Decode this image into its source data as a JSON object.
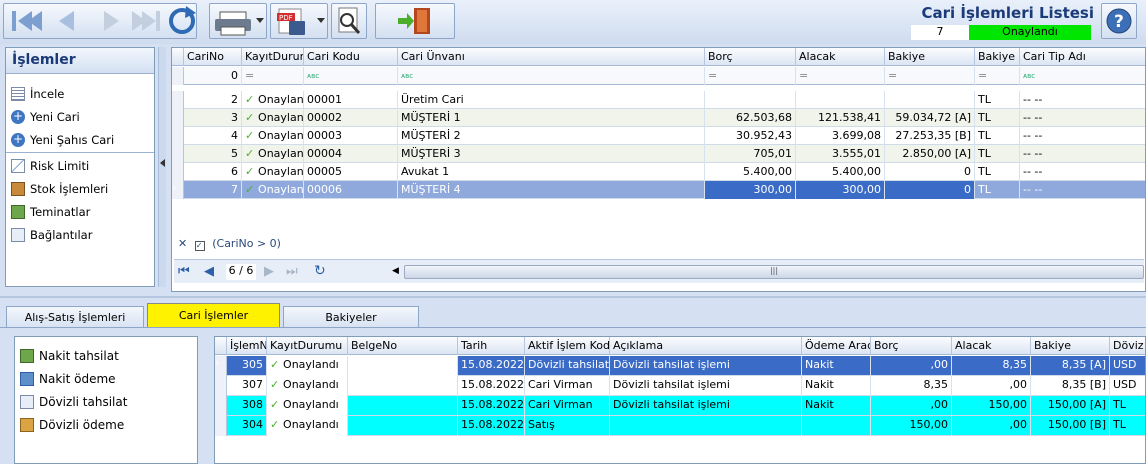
{
  "window": {
    "title": "Cari İşlemleri Listesi",
    "record_count": "7",
    "status": "Onaylandı",
    "status_color": "#00e600"
  },
  "toolbar": {
    "buttons": [
      "first-record-icon",
      "prev-record-icon",
      "next-record-icon",
      "last-record-icon",
      "refresh-icon",
      "print-icon",
      "pdf-save-icon",
      "search-doc-icon",
      "exit-door-icon",
      "help-icon"
    ]
  },
  "left_panel": {
    "title": "İşlemler",
    "items": [
      {
        "label": "İncele",
        "icon": "list-icon"
      },
      {
        "label": "Yeni Cari",
        "icon": "add-icon"
      },
      {
        "label": "Yeni Şahıs Cari",
        "icon": "add-icon"
      },
      {
        "label": "Risk Limiti",
        "icon": "chart-icon"
      },
      {
        "label": "Stok İşlemleri",
        "icon": "box-icon"
      },
      {
        "label": "Teminatlar",
        "icon": "money-icon"
      },
      {
        "label": "Bağlantılar",
        "icon": "link-icon"
      }
    ]
  },
  "top_grid": {
    "columns": [
      "CariNo",
      "KayıtDurumu",
      "Cari Kodu",
      "Cari Ünvanı",
      "Borç",
      "Alacak",
      "Bakiye",
      "Bakiye D",
      "Cari Tip Adı"
    ],
    "filter_value": "0",
    "rows": [
      {
        "no": "2",
        "durum": "Onaylan",
        "kod": "00001",
        "unvan": "Üretim Cari",
        "borc": "",
        "alacak": "",
        "bakiye": "",
        "bd": "TL",
        "tip": "-- --"
      },
      {
        "no": "3",
        "durum": "Onaylan",
        "kod": "00002",
        "unvan": "MÜŞTERİ 1",
        "borc": "62.503,68",
        "alacak": "121.538,41",
        "bakiye": "59.034,72 [A]",
        "bd": "TL",
        "tip": "-- --"
      },
      {
        "no": "4",
        "durum": "Onaylan",
        "kod": "00003",
        "unvan": "MÜŞTERİ 2",
        "borc": "30.952,43",
        "alacak": "3.699,08",
        "bakiye": "27.253,35 [B]",
        "bd": "TL",
        "tip": "-- --"
      },
      {
        "no": "5",
        "durum": "Onaylan",
        "kod": "00004",
        "unvan": "MÜŞTERİ 3",
        "borc": "705,01",
        "alacak": "3.555,01",
        "bakiye": "2.850,00 [A]",
        "bd": "TL",
        "tip": "-- --"
      },
      {
        "no": "6",
        "durum": "Onaylan",
        "kod": "00005",
        "unvan": "Avukat 1",
        "borc": "5.400,00",
        "alacak": "5.400,00",
        "bakiye": "0",
        "bd": "TL",
        "tip": "-- --"
      },
      {
        "no": "7",
        "durum": "Onaylan",
        "kod": "00006",
        "unvan": "MÜŞTERİ 4",
        "borc": "300,00",
        "alacak": "300,00",
        "bakiye": "0",
        "bd": "TL",
        "tip": "-- --"
      }
    ],
    "filter_expr": "(CariNo > 0)",
    "pager": "6 / 6"
  },
  "tabs": [
    "Alış-Satış İşlemleri",
    "Cari İşlemler",
    "Bakiyeler"
  ],
  "bottom_panel": {
    "items": [
      {
        "label": "Nakit tahsilat",
        "icon": "cash-in-icon"
      },
      {
        "label": "Nakit ödeme",
        "icon": "cash-out-icon"
      },
      {
        "label": "Dövizli tahsilat",
        "icon": "fx-in-icon"
      },
      {
        "label": "Dövizli ödeme",
        "icon": "fx-out-icon"
      }
    ]
  },
  "bottom_grid": {
    "columns": [
      "İşlemNo",
      "KayıtDurumu",
      "BelgeNo",
      "Tarih",
      "Aktif İşlem Kodu",
      "Açıklama",
      "Ödeme Aracı",
      "Borç",
      "Alacak",
      "Bakiye",
      "Döviz"
    ],
    "rows": [
      {
        "no": "305",
        "durum": "Onaylandı",
        "belge": "",
        "tarih": "15.08.2022",
        "kod": "Dövizli tahsilat",
        "aciklama": "Dövizli tahsilat işlemi",
        "arac": "Nakit",
        "borc": ",00",
        "alacak": "8,35",
        "bakiye": "8,35 [A]",
        "doviz": "USD"
      },
      {
        "no": "307",
        "durum": "Onaylandı",
        "belge": "",
        "tarih": "15.08.2022",
        "kod": "Cari Virman",
        "aciklama": "Dövizli tahsilat işlemi",
        "arac": "Nakit",
        "borc": "8,35",
        "alacak": ",00",
        "bakiye": "8,35 [B]",
        "doviz": "USD"
      },
      {
        "no": "308",
        "durum": "Onaylandı",
        "belge": "",
        "tarih": "15.08.2022",
        "kod": "Cari Virman",
        "aciklama": "Dövizli tahsilat işlemi",
        "arac": "Nakit",
        "borc": ",00",
        "alacak": "150,00",
        "bakiye": "150,00 [A]",
        "doviz": "TL"
      },
      {
        "no": "304",
        "durum": "Onaylandı",
        "belge": "",
        "tarih": "15.08.2022",
        "kod": "Satış",
        "aciklama": "",
        "arac": "",
        "borc": "150,00",
        "alacak": ",00",
        "bakiye": "150,00 [B]",
        "doviz": "TL"
      }
    ]
  }
}
